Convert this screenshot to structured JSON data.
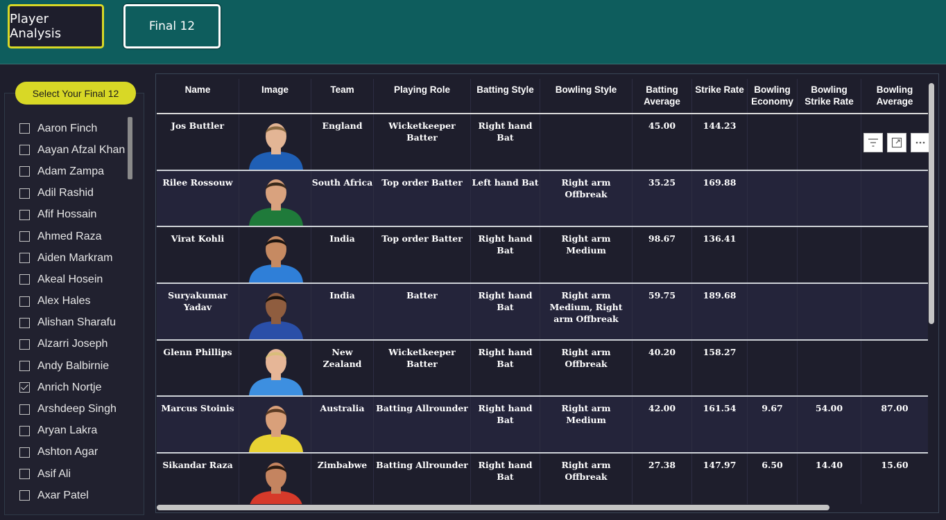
{
  "nav": {
    "player_analysis": "Player Analysis",
    "final12": "Final 12"
  },
  "slicer": {
    "title": "Select Your Final 12",
    "items": [
      {
        "label": "Aaron Finch",
        "checked": false
      },
      {
        "label": "Aayan Afzal Khan",
        "checked": false
      },
      {
        "label": "Adam Zampa",
        "checked": false
      },
      {
        "label": "Adil Rashid",
        "checked": false
      },
      {
        "label": "Afif Hossain",
        "checked": false
      },
      {
        "label": "Ahmed Raza",
        "checked": false
      },
      {
        "label": "Aiden Markram",
        "checked": false
      },
      {
        "label": "Akeal Hosein",
        "checked": false
      },
      {
        "label": "Alex Hales",
        "checked": false
      },
      {
        "label": "Alishan Sharafu",
        "checked": false
      },
      {
        "label": "Alzarri Joseph",
        "checked": false
      },
      {
        "label": "Andy Balbirnie",
        "checked": false
      },
      {
        "label": "Anrich Nortje",
        "checked": true
      },
      {
        "label": "Arshdeep Singh",
        "checked": false
      },
      {
        "label": "Aryan Lakra",
        "checked": false
      },
      {
        "label": "Ashton Agar",
        "checked": false
      },
      {
        "label": "Asif Ali",
        "checked": false
      },
      {
        "label": "Axar Patel",
        "checked": false
      }
    ]
  },
  "visual_header_icons": [
    "filter-icon",
    "focus-mode-icon",
    "more-options-icon"
  ],
  "table": {
    "headers": {
      "name": "Name",
      "image": "Image",
      "team": "Team",
      "role": "Playing Role",
      "bat": "Batting Style",
      "bowl": "Bowling Style",
      "avg": "Batting Average",
      "sr": "Strike Rate",
      "eco": "Bowling Economy",
      "bsr": "Bowling Strike Rate",
      "bavg": "Bowling Average"
    },
    "rows": [
      {
        "name": "Jos Buttler",
        "team": "England",
        "role": "Wicketkeeper Batter",
        "bat": "Right hand Bat",
        "bowl": "",
        "avg": "45.00",
        "sr": "144.23",
        "eco": "",
        "bsr": "",
        "bavg": "",
        "jersey": "#1f5fb5",
        "skin": "#e3b595",
        "hair": "#8a6a42"
      },
      {
        "name": "Rilee Rossouw",
        "team": "South Africa",
        "role": "Top order Batter",
        "bat": "Left hand Bat",
        "bowl": "Right arm Offbreak",
        "avg": "35.25",
        "sr": "169.88",
        "eco": "",
        "bsr": "",
        "bavg": "",
        "jersey": "#1f7a3a",
        "skin": "#d9a27e",
        "hair": "#3a2a1c"
      },
      {
        "name": "Virat Kohli",
        "team": "India",
        "role": "Top order Batter",
        "bat": "Right hand Bat",
        "bowl": "Right arm Medium",
        "avg": "98.67",
        "sr": "136.41",
        "eco": "",
        "bsr": "",
        "bavg": "",
        "jersey": "#2f7fd8",
        "skin": "#c68a62",
        "hair": "#1c1410"
      },
      {
        "name": "Suryakumar Yadav",
        "team": "India",
        "role": "Batter",
        "bat": "Right hand Bat",
        "bowl": "Right arm Medium, Right arm Offbreak",
        "avg": "59.75",
        "sr": "189.68",
        "eco": "",
        "bsr": "",
        "bavg": "",
        "jersey": "#2a4fa8",
        "skin": "#8f5d3f",
        "hair": "#1a120d"
      },
      {
        "name": "Glenn Phillips",
        "team": "New Zealand",
        "role": "Wicketkeeper Batter",
        "bat": "Right hand Bat",
        "bowl": "Right arm Offbreak",
        "avg": "40.20",
        "sr": "158.27",
        "eco": "",
        "bsr": "",
        "bavg": "",
        "jersey": "#3d8fe0",
        "skin": "#e6b697",
        "hair": "#d9bd7a"
      },
      {
        "name": "Marcus Stoinis",
        "team": "Australia",
        "role": "Batting Allrounder",
        "bat": "Right hand Bat",
        "bowl": "Right arm Medium",
        "avg": "42.00",
        "sr": "161.54",
        "eco": "9.67",
        "bsr": "54.00",
        "bavg": "87.00",
        "jersey": "#e8d233",
        "skin": "#d9a07a",
        "hair": "#5a3a22"
      },
      {
        "name": "Sikandar Raza",
        "team": "Zimbabwe",
        "role": "Batting Allrounder",
        "bat": "Right hand Bat",
        "bowl": "Right arm Offbreak",
        "avg": "27.38",
        "sr": "147.97",
        "eco": "6.50",
        "bsr": "14.40",
        "bavg": "15.60",
        "jersey": "#d63a2a",
        "skin": "#c48460",
        "hair": "#2a1a10"
      }
    ]
  }
}
